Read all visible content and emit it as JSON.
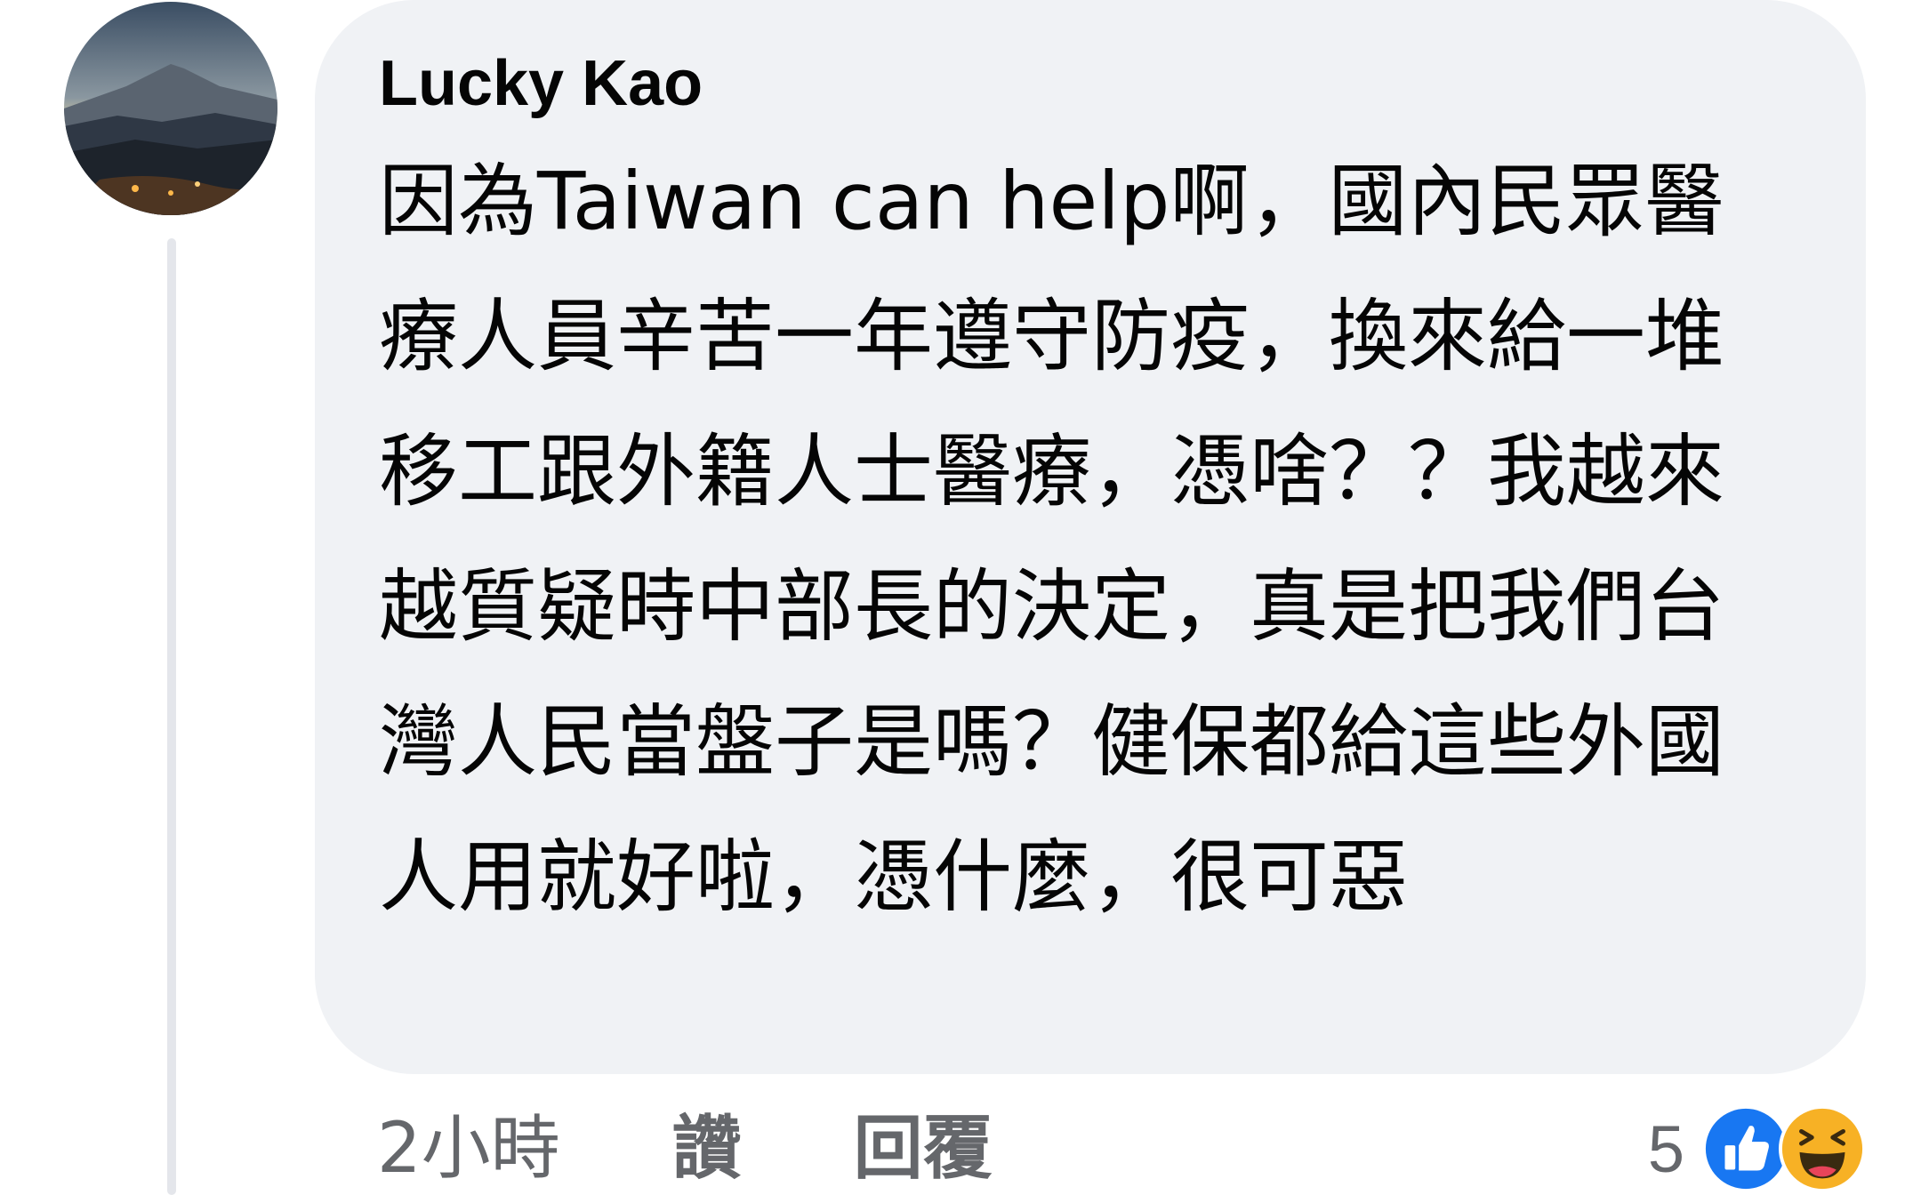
{
  "comment": {
    "author": "Lucky Kao",
    "text": "因為Taiwan can help啊，國內民眾醫療人員辛苦一年遵守防疫，換來給一堆移工跟外籍人士醫療，憑啥？？我越來越質疑時中部長的決定，真是把我們台灣人民當盤子是嗎？健保都給這些外國人用就好啦，憑什麼，很可惡"
  },
  "actions": {
    "time": "2小時",
    "like_label": "讚",
    "reply_label": "回覆"
  },
  "reactions": {
    "count": "5",
    "icons": [
      "like-icon",
      "haha-icon"
    ]
  },
  "colors": {
    "bubble": "#f0f2f5",
    "meta_text": "#65676b",
    "like_blue": "#1877f2",
    "haha_yellow": "#f7b125"
  }
}
